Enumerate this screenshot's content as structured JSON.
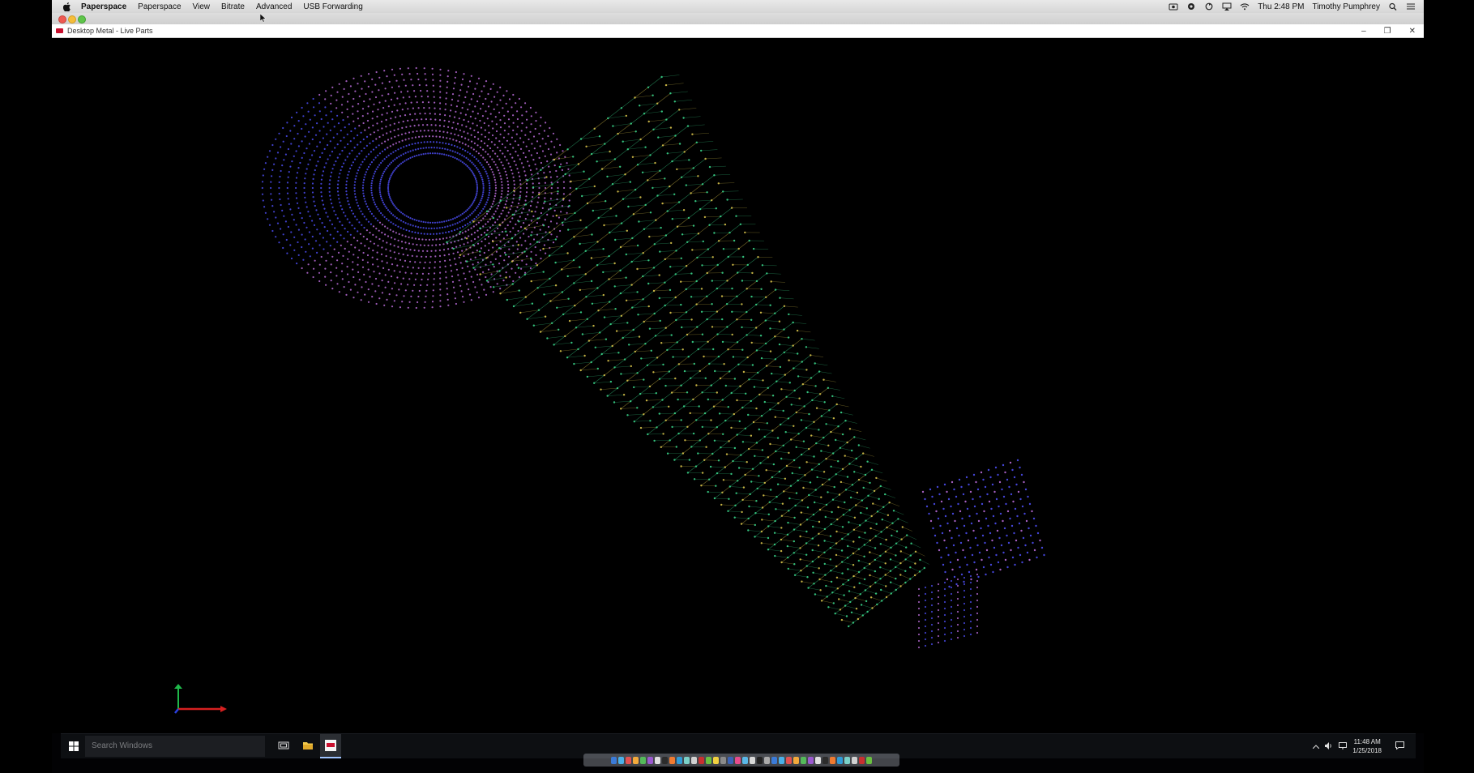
{
  "menubar": {
    "items": [
      "Paperspace",
      "Paperspace",
      "View",
      "Bitrate",
      "Advanced",
      "USB Forwarding"
    ],
    "right": {
      "clock": "Thu 2:48 PM",
      "user": "Timothy Pumphrey"
    }
  },
  "window": {
    "title": "Desktop Metal - Live Parts",
    "controls": {
      "minimize": "–",
      "restore": "❐",
      "close": "✕"
    }
  },
  "taskbar": {
    "search_placeholder": "Search Windows",
    "clock_time": "11:48 AM",
    "clock_date": "1/25/2018"
  },
  "colors": {
    "lattice_purple": "#b86bd8",
    "lattice_blue": "#4b4cf0",
    "lattice_green": "#39d48a",
    "lattice_yellow": "#d8c24a",
    "axis_x": "#d62020",
    "axis_y": "#1fb84a",
    "axis_z": "#2a40e0"
  }
}
